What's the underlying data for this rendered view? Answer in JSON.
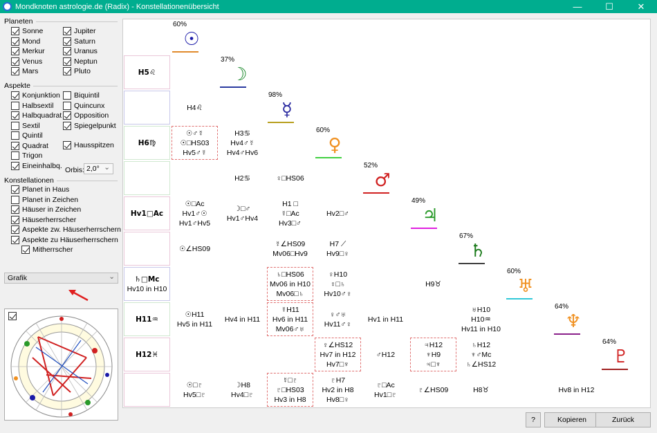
{
  "window": {
    "title": "Mondknoten astrologie.de (Radix) - Konstellationenübersicht",
    "minimize": "—",
    "maximize": "☐",
    "close": "✕"
  },
  "panels": {
    "planeten": {
      "title": "Planeten",
      "items": [
        {
          "label": "Sonne",
          "checked": true
        },
        {
          "label": "Mond",
          "checked": true
        },
        {
          "label": "Merkur",
          "checked": true
        },
        {
          "label": "Venus",
          "checked": true
        },
        {
          "label": "Mars",
          "checked": true
        },
        {
          "label": "Jupiter",
          "checked": true
        },
        {
          "label": "Saturn",
          "checked": true
        },
        {
          "label": "Uranus",
          "checked": true
        },
        {
          "label": "Neptun",
          "checked": true
        },
        {
          "label": "Pluto",
          "checked": true
        }
      ]
    },
    "aspekte": {
      "title": "Aspekte",
      "items": [
        {
          "label": "Konjunktion",
          "checked": true
        },
        {
          "label": "Halbsextil",
          "checked": false
        },
        {
          "label": "Halbquadrat",
          "checked": true
        },
        {
          "label": "Sextil",
          "checked": false
        },
        {
          "label": "Quintil",
          "checked": false
        },
        {
          "label": "Quadrat",
          "checked": true
        },
        {
          "label": "Trigon",
          "checked": false
        },
        {
          "label": "Eineinhalbq.",
          "checked": true
        },
        {
          "label": "Biquintil",
          "checked": false
        },
        {
          "label": "Quincunx",
          "checked": false
        },
        {
          "label": "Opposition",
          "checked": true
        },
        {
          "label": "Spiegelpunkt",
          "checked": true
        },
        {
          "label": "Hausspitzen",
          "checked": true
        }
      ],
      "orbis_label": "Orbis:",
      "orbis_value": "2,0°"
    },
    "konstellationen": {
      "title": "Konstellationen",
      "items": [
        {
          "label": "Planet in Haus",
          "checked": true
        },
        {
          "label": "Planet in Zeichen",
          "checked": false
        },
        {
          "label": "Häuser in Zeichen",
          "checked": true
        },
        {
          "label": "Häuserherrscher",
          "checked": true
        },
        {
          "label": "Aspekte zw. Häuserherrschern",
          "checked": true
        },
        {
          "label": "Aspekte zu Häuserherrschern",
          "checked": true
        },
        {
          "label": "Mitherrscher",
          "checked": true
        }
      ]
    },
    "view_select": "Grafik"
  },
  "planets": [
    {
      "pct": "60%",
      "sym": "☉",
      "color": "#1a1aa8",
      "ul": "#e08a2c"
    },
    {
      "pct": "37%",
      "sym": "☽",
      "color": "#1e8a2e",
      "ul": "#2a3aa0"
    },
    {
      "pct": "98%",
      "sym": "☿",
      "color": "#2a2aa0",
      "ul": "#b8a020"
    },
    {
      "pct": "60%",
      "sym": "♀",
      "color": "#f09020",
      "ul": "#40d040"
    },
    {
      "pct": "52%",
      "sym": "♂",
      "color": "#d02020",
      "ul": "#d02020"
    },
    {
      "pct": "49%",
      "sym": "♃",
      "color": "#2a9a2a",
      "ul": "#e020e0"
    },
    {
      "pct": "67%",
      "sym": "♄",
      "color": "#1a7a1a",
      "ul": "#404040"
    },
    {
      "pct": "60%",
      "sym": "♅",
      "color": "#f09020",
      "ul": "#30c8d8"
    },
    {
      "pct": "64%",
      "sym": "♆",
      "color": "#f09020",
      "ul": "#8a208a"
    },
    {
      "pct": "64%",
      "sym": "♇",
      "color": "#d02020",
      "ul": "#a02020"
    }
  ],
  "rows": [
    {
      "h": "H5♌"
    },
    {
      "h": ""
    },
    {
      "h": "H6♍"
    },
    {
      "h": ""
    },
    {
      "h": "Hv1□Ac"
    },
    {
      "h": ""
    },
    {
      "h": "♄□Mc"
    },
    {
      "h": "H11♒"
    },
    {
      "h": "H12♓"
    },
    {
      "h": ""
    }
  ],
  "row_sub": {
    "6": "Hv10 in H10"
  },
  "cells": [
    {
      "r": 1,
      "c": 1,
      "lines": [
        "H4♌"
      ]
    },
    {
      "r": 2,
      "c": 1,
      "lines": [
        "☉♂☿",
        "☉□HS03",
        "Hv5♂☿"
      ],
      "dot": true
    },
    {
      "r": 2,
      "c": 2,
      "lines": [
        "H3♋",
        "Hv4♂☿",
        "Hv4♂Hv6"
      ]
    },
    {
      "r": 3,
      "c": 2,
      "lines": [
        "H2♋"
      ]
    },
    {
      "r": 3,
      "c": 3,
      "lines": [
        "♀□HS06"
      ]
    },
    {
      "r": 4,
      "c": 1,
      "lines": [
        "☉□Ac",
        "Hv1♂☉",
        "Hv1♂Hv5"
      ]
    },
    {
      "r": 4,
      "c": 2,
      "lines": [
        "☽□♂",
        "Hv1♂Hv4"
      ]
    },
    {
      "r": 4,
      "c": 3,
      "lines": [
        "H1 □",
        "☿□Ac",
        "Hv3□♂"
      ]
    },
    {
      "r": 4,
      "c": 4,
      "lines": [
        "Hv2□♂"
      ]
    },
    {
      "r": 5,
      "c": 1,
      "lines": [
        "☉∠HS09"
      ]
    },
    {
      "r": 5,
      "c": 3,
      "lines": [
        "☿∠HS09",
        "Mv06□Hv9"
      ]
    },
    {
      "r": 5,
      "c": 4,
      "lines": [
        "H7 ⟋",
        "Hv9□♀"
      ]
    },
    {
      "r": 6,
      "c": 3,
      "lines": [
        "♄□HS06",
        "Mv06 in H10",
        "Mv06□♄"
      ],
      "dot": true
    },
    {
      "r": 6,
      "c": 4,
      "lines": [
        "♀H10",
        "♀□♄",
        "Hv10♂♀"
      ]
    },
    {
      "r": 6,
      "c": 6,
      "lines": [
        "H9♉"
      ]
    },
    {
      "r": 7,
      "c": 1,
      "lines": [
        "☉H11",
        "Hv5 in H11"
      ]
    },
    {
      "r": 7,
      "c": 2,
      "lines": [
        "Hv4 in H11"
      ]
    },
    {
      "r": 7,
      "c": 3,
      "lines": [
        "☿H11",
        "Hv6 in H11",
        "Mv06♂♅"
      ],
      "dot": true
    },
    {
      "r": 7,
      "c": 4,
      "lines": [
        "♀♂♅",
        "Hv11♂♀"
      ]
    },
    {
      "r": 7,
      "c": 5,
      "lines": [
        "Hv1 in H11"
      ]
    },
    {
      "r": 7,
      "c": 7,
      "lines": [
        "♅H10",
        "H10♒",
        "Hv11 in H10"
      ]
    },
    {
      "r": 8,
      "c": 4,
      "lines": [
        "♀∠HS12",
        "Hv7 in H12",
        "Hv7□♆"
      ],
      "dot": true
    },
    {
      "r": 8,
      "c": 5,
      "lines": [
        "♂H12"
      ]
    },
    {
      "r": 8,
      "c": 6,
      "lines": [
        "♃H12",
        "♆H9",
        "♃□♆"
      ],
      "dot": true
    },
    {
      "r": 8,
      "c": 7,
      "lines": [
        "♄H12",
        "♆♂Mc",
        "♄∠HS12"
      ]
    },
    {
      "r": 9,
      "c": 1,
      "lines": [
        "☉□♇",
        "Hv5□♇"
      ]
    },
    {
      "r": 9,
      "c": 2,
      "lines": [
        "☽H8",
        "Hv4□♇"
      ]
    },
    {
      "r": 9,
      "c": 3,
      "lines": [
        "☿□♇",
        "♇□HS03",
        "Hv3 in H8"
      ],
      "dot": true
    },
    {
      "r": 9,
      "c": 4,
      "lines": [
        "♇H7",
        "Hv2 in H8",
        "Hv8□♀"
      ]
    },
    {
      "r": 9,
      "c": 5,
      "lines": [
        "♇□Ac",
        "Hv1□♇"
      ]
    },
    {
      "r": 9,
      "c": 6,
      "lines": [
        "♇∠HS09"
      ]
    },
    {
      "r": 9,
      "c": 7,
      "lines": [
        "H8♉"
      ]
    },
    {
      "r": 9,
      "c": 9,
      "lines": [
        "Hv8 in H12"
      ]
    }
  ],
  "buttons": {
    "help": "?",
    "copy": "Kopieren",
    "back": "Zurück"
  }
}
